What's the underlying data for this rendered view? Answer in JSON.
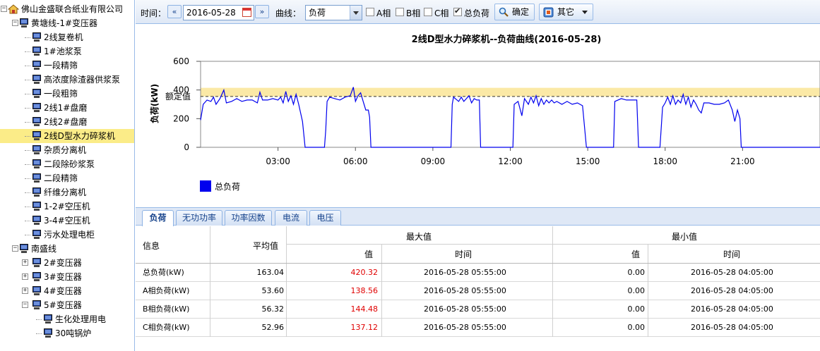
{
  "tree": {
    "root_label": "佛山金盛联合纸业有限公司",
    "nodes": [
      {
        "label": "黄塘线-1#变压器",
        "level": 1,
        "toggle": "−"
      },
      {
        "label": "2线复卷机",
        "level": 2
      },
      {
        "label": "1#池浆泵",
        "level": 2
      },
      {
        "label": "一段精筛",
        "level": 2
      },
      {
        "label": "高浓度除渣器供浆泵",
        "level": 2
      },
      {
        "label": "一段粗筛",
        "level": 2
      },
      {
        "label": "2线1#盘磨",
        "level": 2
      },
      {
        "label": "2线2#盘磨",
        "level": 2
      },
      {
        "label": "2线D型水力碎浆机",
        "level": 2,
        "selected": true
      },
      {
        "label": "杂质分离机",
        "level": 2
      },
      {
        "label": "二段除砂浆泵",
        "level": 2
      },
      {
        "label": "二段精筛",
        "level": 2
      },
      {
        "label": "纤维分离机",
        "level": 2
      },
      {
        "label": "1-2#空压机",
        "level": 2
      },
      {
        "label": "3-4#空压机",
        "level": 2
      },
      {
        "label": "污水处理电柜",
        "level": 2
      },
      {
        "label": "南盛线",
        "level": 1,
        "toggle": "−"
      },
      {
        "label": "2#变压器",
        "level": 2,
        "toggle": "+"
      },
      {
        "label": "3#变压器",
        "level": 2,
        "toggle": "+"
      },
      {
        "label": "4#变压器",
        "level": 2,
        "toggle": "+"
      },
      {
        "label": "5#变压器",
        "level": 2,
        "toggle": "−"
      },
      {
        "label": "生化处理用电",
        "level": 3
      },
      {
        "label": "30吨锅炉",
        "level": 3
      }
    ]
  },
  "toolbar": {
    "time_label": "时间：",
    "prev_label": "«",
    "next_label": "»",
    "date_value": "2016-05-28",
    "curve_label": "曲线：",
    "curve_value": "负荷",
    "checkboxes": [
      {
        "label": "A相",
        "checked": false
      },
      {
        "label": "B相",
        "checked": false
      },
      {
        "label": "C相",
        "checked": false
      },
      {
        "label": "总负荷",
        "checked": true
      }
    ],
    "confirm_label": "确定",
    "other_label": "其它"
  },
  "chart_data": {
    "type": "line",
    "title": "2线D型水力碎浆机--负荷曲线(2016-05-28)",
    "ylabel": "负荷(kW)",
    "xlabel": "",
    "ylim": [
      0,
      600
    ],
    "yticks": [
      0,
      200,
      400,
      600
    ],
    "xlim_hours": [
      0,
      24
    ],
    "xticks": [
      "03:00",
      "06:00",
      "09:00",
      "12:00",
      "15:00",
      "18:00",
      "21:00"
    ],
    "rated_label": "额定值",
    "rated_value": 355,
    "band": [
      355,
      415
    ],
    "series": [
      {
        "name": "总负荷",
        "color": "#0000ee",
        "points": [
          [
            0,
            190
          ],
          [
            0.1,
            300
          ],
          [
            0.25,
            330
          ],
          [
            0.4,
            320
          ],
          [
            0.5,
            350
          ],
          [
            0.6,
            300
          ],
          [
            0.75,
            340
          ],
          [
            0.9,
            400
          ],
          [
            1.0,
            310
          ],
          [
            1.2,
            320
          ],
          [
            1.4,
            340
          ],
          [
            1.6,
            320
          ],
          [
            1.8,
            330
          ],
          [
            2.0,
            330
          ],
          [
            2.2,
            310
          ],
          [
            2.3,
            385
          ],
          [
            2.4,
            330
          ],
          [
            2.6,
            330
          ],
          [
            2.8,
            340
          ],
          [
            3.0,
            330
          ],
          [
            3.1,
            350
          ],
          [
            3.2,
            310
          ],
          [
            3.3,
            390
          ],
          [
            3.4,
            320
          ],
          [
            3.5,
            360
          ],
          [
            3.6,
            300
          ],
          [
            3.7,
            370
          ],
          [
            3.8,
            300
          ],
          [
            3.9,
            220
          ],
          [
            3.95,
            180
          ],
          [
            4.05,
            0
          ],
          [
            4.8,
            0
          ],
          [
            4.85,
            120
          ],
          [
            4.9,
            320
          ],
          [
            5.0,
            350
          ],
          [
            5.2,
            340
          ],
          [
            5.4,
            330
          ],
          [
            5.6,
            350
          ],
          [
            5.8,
            360
          ],
          [
            5.92,
            420
          ],
          [
            6.0,
            320
          ],
          [
            6.1,
            360
          ],
          [
            6.2,
            380
          ],
          [
            6.3,
            320
          ],
          [
            6.4,
            260
          ],
          [
            6.5,
            260
          ],
          [
            6.55,
            210
          ],
          [
            6.6,
            0
          ],
          [
            9.7,
            0
          ],
          [
            9.75,
            300
          ],
          [
            9.8,
            350
          ],
          [
            10.0,
            320
          ],
          [
            10.1,
            350
          ],
          [
            10.2,
            320
          ],
          [
            10.4,
            360
          ],
          [
            10.5,
            310
          ],
          [
            10.6,
            340
          ],
          [
            10.7,
            330
          ],
          [
            10.8,
            330
          ],
          [
            10.85,
            0
          ],
          [
            12.1,
            0
          ],
          [
            12.15,
            300
          ],
          [
            12.3,
            320
          ],
          [
            12.45,
            220
          ],
          [
            12.55,
            340
          ],
          [
            12.7,
            300
          ],
          [
            12.8,
            350
          ],
          [
            12.9,
            310
          ],
          [
            13.0,
            360
          ],
          [
            13.1,
            290
          ],
          [
            13.2,
            340
          ],
          [
            13.3,
            300
          ],
          [
            13.4,
            330
          ],
          [
            13.5,
            310
          ],
          [
            13.6,
            330
          ],
          [
            13.7,
            310
          ],
          [
            13.8,
            320
          ],
          [
            14.0,
            300
          ],
          [
            14.2,
            320
          ],
          [
            14.4,
            300
          ],
          [
            14.6,
            310
          ],
          [
            14.8,
            290
          ],
          [
            14.95,
            0
          ],
          [
            16.0,
            0
          ],
          [
            16.05,
            320
          ],
          [
            16.3,
            340
          ],
          [
            16.5,
            330
          ],
          [
            16.7,
            330
          ],
          [
            16.9,
            330
          ],
          [
            16.97,
            0
          ],
          [
            17.8,
            0
          ],
          [
            17.9,
            280
          ],
          [
            18.0,
            310
          ],
          [
            18.1,
            350
          ],
          [
            18.2,
            300
          ],
          [
            18.3,
            360
          ],
          [
            18.4,
            300
          ],
          [
            18.5,
            330
          ],
          [
            18.6,
            310
          ],
          [
            18.7,
            370
          ],
          [
            18.8,
            300
          ],
          [
            18.9,
            350
          ],
          [
            19.0,
            280
          ],
          [
            19.1,
            330
          ],
          [
            19.2,
            300
          ],
          [
            19.3,
            260
          ],
          [
            19.4,
            240
          ],
          [
            19.5,
            310
          ],
          [
            19.7,
            310
          ],
          [
            19.9,
            300
          ],
          [
            20.1,
            300
          ],
          [
            20.3,
            310
          ],
          [
            20.45,
            330
          ],
          [
            20.6,
            260
          ],
          [
            20.7,
            180
          ],
          [
            20.8,
            260
          ],
          [
            20.9,
            200
          ],
          [
            20.95,
            0
          ],
          [
            24,
            0
          ]
        ]
      }
    ],
    "legend": "bottom-left"
  },
  "tabs": [
    {
      "label": "负荷",
      "active": true
    },
    {
      "label": "无功功率"
    },
    {
      "label": "功率因数"
    },
    {
      "label": "电流"
    },
    {
      "label": "电压"
    }
  ],
  "grid": {
    "headers": {
      "info": "信息",
      "avg": "平均值",
      "max": "最大值",
      "min": "最小值",
      "value": "值",
      "time": "时间"
    },
    "rows": [
      {
        "info": "总负荷(kW)",
        "avg": "163.04",
        "max_val": "420.32",
        "max_time": "2016-05-28 05:55:00",
        "min_val": "0.00",
        "min_time": "2016-05-28 04:05:00"
      },
      {
        "info": "A相负荷(kW)",
        "avg": "53.60",
        "max_val": "138.56",
        "max_time": "2016-05-28 05:55:00",
        "min_val": "0.00",
        "min_time": "2016-05-28 04:05:00"
      },
      {
        "info": "B相负荷(kW)",
        "avg": "56.32",
        "max_val": "144.48",
        "max_time": "2016-05-28 05:55:00",
        "min_val": "0.00",
        "min_time": "2016-05-28 04:05:00"
      },
      {
        "info": "C相负荷(kW)",
        "avg": "52.96",
        "max_val": "137.12",
        "max_time": "2016-05-28 05:55:00",
        "min_val": "0.00",
        "min_time": "2016-05-28 04:05:00"
      }
    ]
  }
}
